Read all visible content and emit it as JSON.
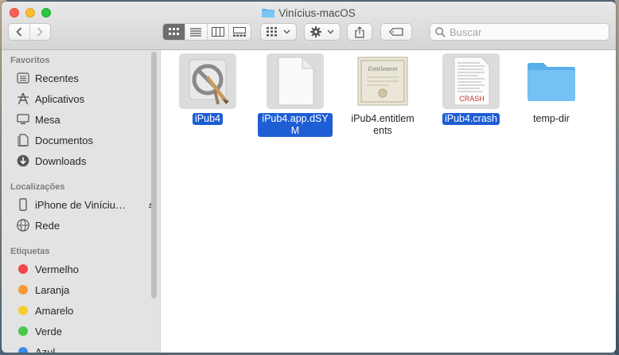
{
  "window": {
    "title": "Vinícius-macOS"
  },
  "toolbar": {
    "back_label": "‹",
    "forward_label": "›",
    "view_modes": [
      "icon-view",
      "list-view",
      "column-view",
      "gallery-view"
    ],
    "group_label": "group-by",
    "action_label": "actions",
    "share_label": "share",
    "tag_label": "edit-tags"
  },
  "search": {
    "placeholder": "Buscar",
    "value": ""
  },
  "sidebar": {
    "favorites_header": "Favoritos",
    "favorites": [
      {
        "label": "Recentes",
        "icon": "clock-icon"
      },
      {
        "label": "Aplicativos",
        "icon": "applications-icon"
      },
      {
        "label": "Mesa",
        "icon": "desktop-icon"
      },
      {
        "label": "Documentos",
        "icon": "document-icon"
      },
      {
        "label": "Downloads",
        "icon": "download-icon"
      }
    ],
    "locations_header": "Localizações",
    "locations": [
      {
        "label": "iPhone de Vinícius…",
        "icon": "iphone-icon"
      },
      {
        "label": "Rede",
        "icon": "network-icon"
      }
    ],
    "tags_header": "Etiquetas",
    "tags": [
      {
        "label": "Vermelho",
        "color": "#f3434b"
      },
      {
        "label": "Laranja",
        "color": "#f79a2e"
      },
      {
        "label": "Amarelo",
        "color": "#f5cf2e"
      },
      {
        "label": "Verde",
        "color": "#49c84a"
      },
      {
        "label": "Azul",
        "color": "#3c8cf0"
      }
    ]
  },
  "files": [
    {
      "name": "iPub4",
      "type": "app",
      "selected": true
    },
    {
      "name": "iPub4.app.dSYM",
      "type": "document",
      "selected": true
    },
    {
      "name": "iPub4.entitlements",
      "type": "certificate",
      "selected": false,
      "thumb_text": "Entitlement"
    },
    {
      "name": "iPub4.crash",
      "type": "crash-log",
      "selected": true,
      "thumb_text": "CRASH"
    },
    {
      "name": "temp-dir",
      "type": "folder",
      "selected": false
    }
  ],
  "colors": {
    "selection": "#1e5ed4",
    "folder": "#5fb4ee"
  }
}
